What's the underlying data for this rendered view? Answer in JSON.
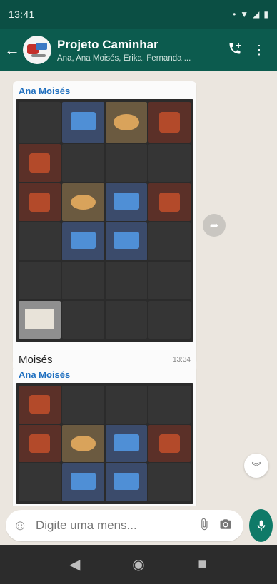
{
  "status_bar": {
    "time": "13:41"
  },
  "header": {
    "title": "Projeto Caminhar",
    "members": "Ana, Ana Moisés, Erika, Fernanda ..."
  },
  "messages": [
    {
      "sender": "Ana Moisés",
      "caption": "Moisés",
      "time": "13:34"
    },
    {
      "sender": "Ana Moisés"
    }
  ],
  "composer": {
    "placeholder": "Digite uma mens..."
  },
  "colors": {
    "header_bg": "#0c5b4e",
    "status_bg": "#0b4f44",
    "accent": "#0f7a68",
    "sender_name": "#1f6fbf",
    "chat_bg": "#ebe6df"
  },
  "icons": {
    "back": "arrow-left-icon",
    "call": "add-call-icon",
    "menu": "more-vertical-icon",
    "forward": "share-icon",
    "scroll": "chevrons-down-icon",
    "emoji": "emoji-icon",
    "attach": "paperclip-icon",
    "camera": "camera-icon",
    "mic": "microphone-icon"
  }
}
